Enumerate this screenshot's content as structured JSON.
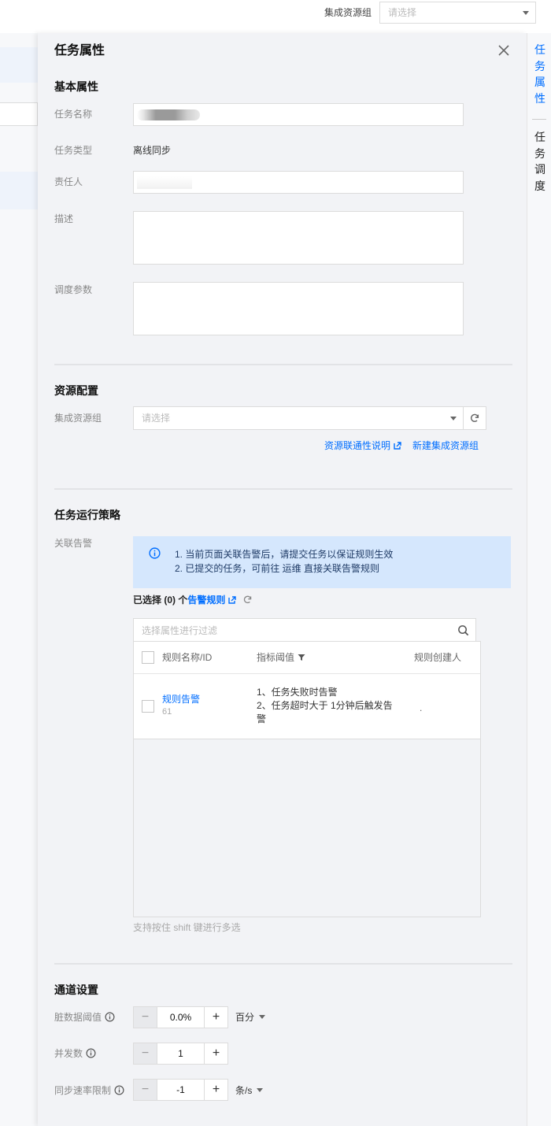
{
  "topbar": {
    "resource_group_label": "集成资源组",
    "resource_group_placeholder": "请选择"
  },
  "drawer": {
    "title": "任务属性",
    "basic": {
      "section_title": "基本属性",
      "task_name_label": "任务名称",
      "task_type_label": "任务类型",
      "task_type_value": "离线同步",
      "owner_label": "责任人",
      "description_label": "描述",
      "schedule_params_label": "调度参数"
    },
    "resource": {
      "section_title": "资源配置",
      "group_label": "集成资源组",
      "group_placeholder": "请选择",
      "connectivity_link": "资源联通性说明",
      "new_group_link": "新建集成资源组"
    },
    "policy": {
      "section_title": "任务运行策略",
      "alarm_label": "关联告警",
      "alert_line1": "1. 当前页面关联告警后，请提交任务以保证规则生效",
      "alert_line2": "2. 已提交的任务，可前往 运维 直接关联告警规则",
      "selected_prefix": "已选择 ",
      "selected_count": "(0)",
      "selected_unit": " 个",
      "alarm_rules_link": "告警规则",
      "filter_placeholder": "选择属性进行过滤",
      "columns": {
        "name": "规则名称/ID",
        "threshold": "指标阈值",
        "creator": "规则创建人"
      },
      "rows": [
        {
          "name": "规则告警",
          "id": "61",
          "cond1": "1、任务失败时告警",
          "cond2": "2、任务超时大于 1分钟后触发告警",
          "creator": "."
        }
      ],
      "hint": "支持按住 shift 键进行多选"
    },
    "channel": {
      "section_title": "通道设置",
      "dirty_label": "脏数据阈值",
      "dirty_value": "0.0%",
      "dirty_unit": "百分",
      "concurrency_label": "并发数",
      "concurrency_value": "1",
      "rate_label": "同步速率限制",
      "rate_value": "-1",
      "rate_unit": "条/s",
      "minus": "−",
      "plus": "+"
    }
  },
  "anchor_nav": {
    "item1": "任务属性",
    "item2": "任务调度"
  },
  "colors": {
    "accent": "#006eff",
    "alert_bg": "#d5e7fd",
    "drawer_bg": "#f2f3f6"
  }
}
